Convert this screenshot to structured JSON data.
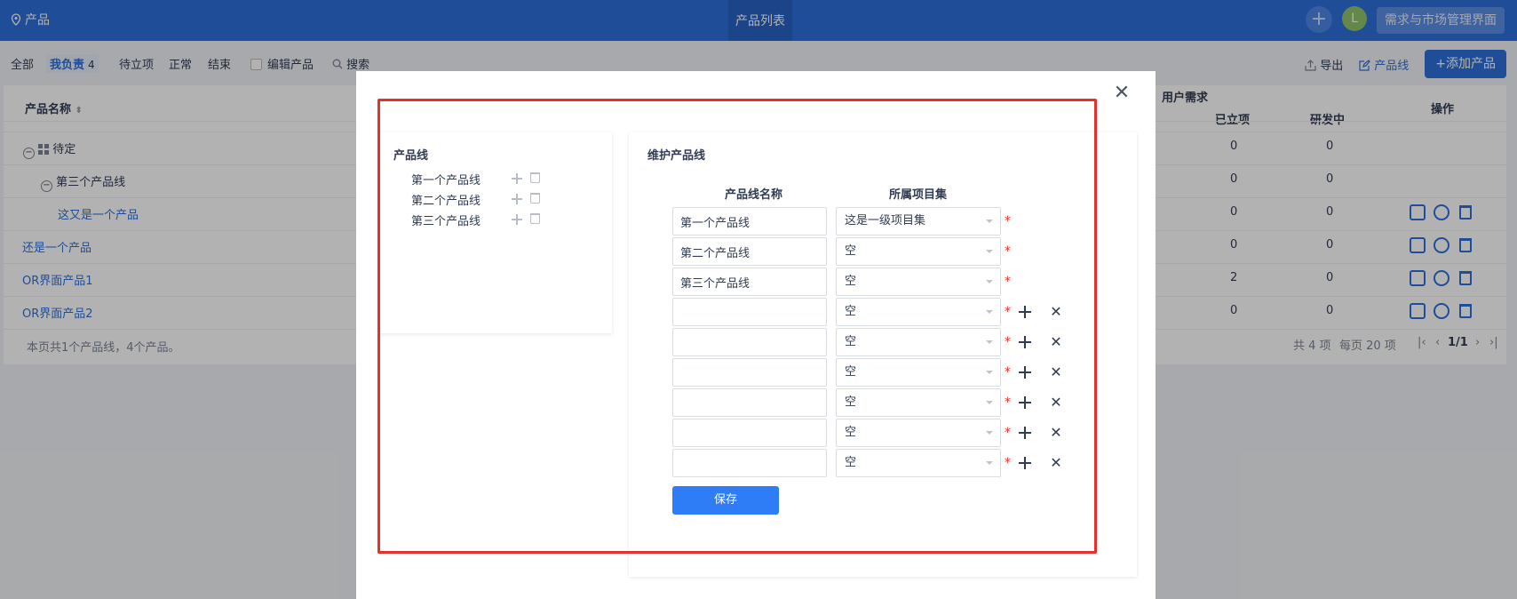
{
  "header": {
    "location": "产品",
    "center_tab": "产品列表",
    "avatar_letter": "L",
    "market_button": "需求与市场管理界面"
  },
  "filters": {
    "all": "全部",
    "mine": "我负责",
    "mine_count": "4",
    "pending": "待立项",
    "normal": "正常",
    "closed": "结束",
    "edit_product": "编辑产品",
    "search": "搜索"
  },
  "actions": {
    "export": "导出",
    "product_line": "产品线",
    "add_product": "+添加产品"
  },
  "table": {
    "headers": {
      "name": "产品名称",
      "user_req": "用户需求",
      "approved": "已立项",
      "developing": "研发中",
      "ops": "操作"
    },
    "rows": [
      {
        "name": "待定",
        "approved": "0",
        "developing": "0"
      },
      {
        "name": "第三个产品线",
        "approved": "0",
        "developing": "0"
      },
      {
        "name": "这又是一个产品",
        "approved": "0",
        "developing": "0"
      },
      {
        "name": "还是一个产品",
        "approved": "0",
        "developing": "0"
      },
      {
        "name": "OR界面产品1",
        "approved": "2",
        "developing": "0"
      },
      {
        "name": "OR界面产品2",
        "approved": "0",
        "developing": "0"
      }
    ],
    "summary": "本页共1个产品线，4个产品。",
    "pager": {
      "total": "共 4 项",
      "per_page": "每页 20 项",
      "page": "1/1"
    }
  },
  "modal": {
    "left_title": "产品线",
    "left_items": [
      "第一个产品线",
      "第二个产品线",
      "第三个产品线"
    ],
    "right_title": "维护产品线",
    "col_name": "产品线名称",
    "col_program": "所属项目集",
    "rows": [
      {
        "name": "第一个产品线",
        "program": "这是一级项目集",
        "removable": false
      },
      {
        "name": "第二个产品线",
        "program": "空",
        "removable": false
      },
      {
        "name": "第三个产品线",
        "program": "空",
        "removable": false
      },
      {
        "name": "",
        "program": "空",
        "removable": true
      },
      {
        "name": "",
        "program": "空",
        "removable": true
      },
      {
        "name": "",
        "program": "空",
        "removable": true
      },
      {
        "name": "",
        "program": "空",
        "removable": true
      },
      {
        "name": "",
        "program": "空",
        "removable": true
      },
      {
        "name": "",
        "program": "空",
        "removable": true
      }
    ],
    "required_mark": "*",
    "save_label": "保存"
  },
  "colors": {
    "header_bg": "#2e6fd9",
    "primary": "#2e7cf6",
    "highlight_border": "#e5302b"
  }
}
